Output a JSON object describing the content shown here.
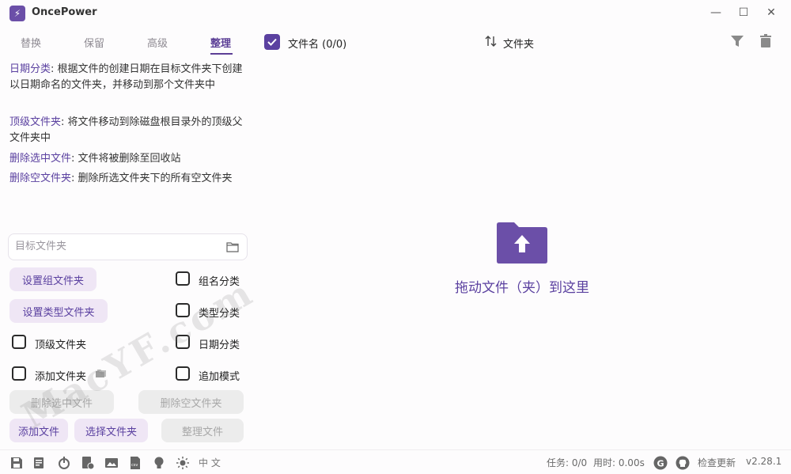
{
  "app": {
    "title": "OncePower",
    "logo_glyph": "⚡"
  },
  "window": {
    "minimize": "—",
    "maximize": "☐",
    "close": "✕"
  },
  "tabs": [
    {
      "label": "替换",
      "active": false
    },
    {
      "label": "保留",
      "active": false
    },
    {
      "label": "高级",
      "active": false
    },
    {
      "label": "整理",
      "active": true
    }
  ],
  "descriptions": [
    {
      "keyword": "日期分类",
      "text": ": 根据文件的创建日期在目标文件夹下创建以日期命名的文件夹，并移动到那个文件夹中"
    },
    {
      "keyword": "顶级文件夹",
      "text": ": 将文件移动到除磁盘根目录外的顶级父文件夹中"
    },
    {
      "keyword": "删除选中文件",
      "text": ": 文件将被删除至回收站"
    },
    {
      "keyword": "删除空文件夹",
      "text": ": 删除所选文件夹下的所有空文件夹"
    }
  ],
  "target_folder": {
    "placeholder": "目标文件夹",
    "value": ""
  },
  "buttons": {
    "set_group_folder": "设置组文件夹",
    "set_type_folder": "设置类型文件夹",
    "delete_selected": "删除选中文件",
    "delete_empty": "删除空文件夹",
    "add_files": "添加文件",
    "select_folder": "选择文件夹",
    "organize_files": "整理文件"
  },
  "checkboxes": {
    "group_classify": {
      "label": "组名分类",
      "checked": false
    },
    "type_classify": {
      "label": "类型分类",
      "checked": false
    },
    "top_folder": {
      "label": "顶级文件夹",
      "checked": false
    },
    "date_classify": {
      "label": "日期分类",
      "checked": false
    },
    "add_folder": {
      "label": "添加文件夹",
      "checked": false
    },
    "append_mode": {
      "label": "追加模式",
      "checked": false
    }
  },
  "file_list": {
    "header_checked": true,
    "name_header": "文件名 (0/0)",
    "sort_header": "文件夹",
    "drop_text": "拖动文件（夹）到这里"
  },
  "status": {
    "tasks": "任务: 0/0",
    "elapsed": "用时: 0.00s",
    "check_update": "检查更新",
    "version": "v2.28.1"
  },
  "bottom_lang": "中 文",
  "watermark": "MacYF.com",
  "colors": {
    "accent": "#5b41a0",
    "pill_bg": "#efe6f5",
    "disabled_bg": "#ececec"
  }
}
